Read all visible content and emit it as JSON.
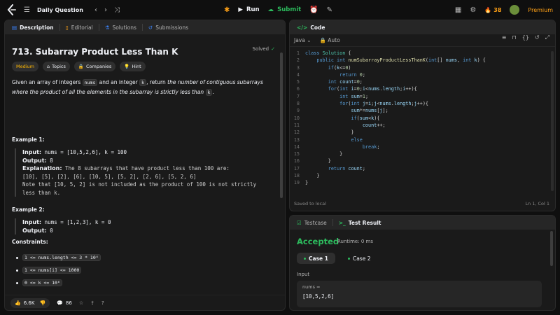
{
  "topbar": {
    "title": "Daily Question",
    "run_label": "Run",
    "submit_label": "Submit",
    "streak": "38",
    "premium_label": "Premium"
  },
  "left_tabs": [
    {
      "label": "Description"
    },
    {
      "label": "Editorial"
    },
    {
      "label": "Solutions"
    },
    {
      "label": "Submissions"
    }
  ],
  "problem": {
    "title": "713. Subarray Product Less Than K",
    "status": "Solved",
    "tags": [
      "Medium",
      "Topics",
      "Companies",
      "Hint"
    ],
    "desc_1": "Given an array of integers ",
    "desc_code_1": "nums",
    "desc_2": " and an integer ",
    "desc_code_2": "k",
    "desc_3": ", return ",
    "desc_italic": "the number of contiguous subarrays where the product of all the elements in the subarray is strictly less than ",
    "desc_code_3": "k",
    "desc_4": ".",
    "example1_title": "Example 1:",
    "example1_input_label": "Input:",
    "example1_input": " nums = [10,5,2,6], k = 100",
    "example1_output_label": "Output:",
    "example1_output": " 8",
    "example1_expl_label": "Explanation:",
    "example1_expl_1": " The 8 subarrays that have product less than 100 are:",
    "example1_expl_2": "[10], [5], [2], [6], [10, 5], [5, 2], [2, 6], [5, 2, 6]",
    "example1_expl_3": "Note that [10, 5, 2] is not included as the product of 100 is not strictly",
    "example1_expl_4": "less than k.",
    "example2_title": "Example 2:",
    "example2_input_label": "Input:",
    "example2_input": " nums = [1,2,3], k = 0",
    "example2_output_label": "Output:",
    "example2_output": " 0",
    "constraints_title": "Constraints:",
    "constraints": [
      "1 <= nums.length <= 3 * 10⁴",
      "1 <= nums[i] <= 1000",
      "0 <= k <= 10⁶"
    ]
  },
  "bottom": {
    "likes": "6.6K",
    "comments": "86"
  },
  "code_panel": {
    "title": "Code",
    "language": "Java",
    "mode": "Auto",
    "saved": "Saved to local",
    "cursor": "Ln 1, Col 1",
    "lines": [
      "class Solution {",
      "    public int numSubarrayProductLessThanK(int[] nums, int k) {",
      "        if(k<=0)",
      "            return 0;",
      "        int count=0;",
      "        for(int i=0;i<nums.length;i++){",
      "            int sum=1;",
      "            for(int j=i;j<nums.length;j++){",
      "                sum*=nums[j];",
      "                if(sum<k){",
      "                    count++;",
      "                }",
      "                else",
      "                    break;",
      "            }",
      "        }",
      "        return count;",
      "    }",
      "}"
    ]
  },
  "test_panel": {
    "tab_testcase": "Testcase",
    "tab_result": "Test Result",
    "verdict": "Accepted",
    "runtime": "Runtime: 0 ms",
    "cases": [
      "Case 1",
      "Case 2"
    ],
    "input_label": "Input",
    "input_name": "nums =",
    "input_value": "[10,5,2,6]"
  },
  "colors": {
    "accent_orange": "#ffa116",
    "accepted_green": "#2cbb5d",
    "medium_yellow": "#ffb800"
  }
}
